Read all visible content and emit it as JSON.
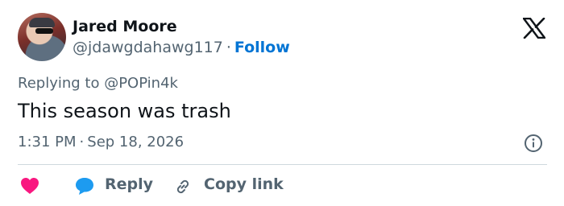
{
  "author": {
    "name": "Jared Moore",
    "handle": "@jdawgdahawg117",
    "separator": "·",
    "follow_label": "Follow"
  },
  "reply_context": {
    "prefix": "Replying to ",
    "target": "@POPin4k"
  },
  "tweet": {
    "text": "This season was trash",
    "time": "1:31 PM",
    "separator": "·",
    "date": "Sep 18, 2026"
  },
  "actions": {
    "reply_label": "Reply",
    "copy_link_label": "Copy link"
  },
  "icons": {
    "logo": "x-logo-icon",
    "info": "info-icon",
    "like": "heart-icon",
    "reply": "speech-bubble-icon",
    "copy": "link-icon"
  },
  "colors": {
    "text": "#0f1419",
    "secondary": "#536471",
    "follow": "#0074d4",
    "heart": "#f91880",
    "reply": "#1d9bf0",
    "divider": "#cfd9de"
  }
}
